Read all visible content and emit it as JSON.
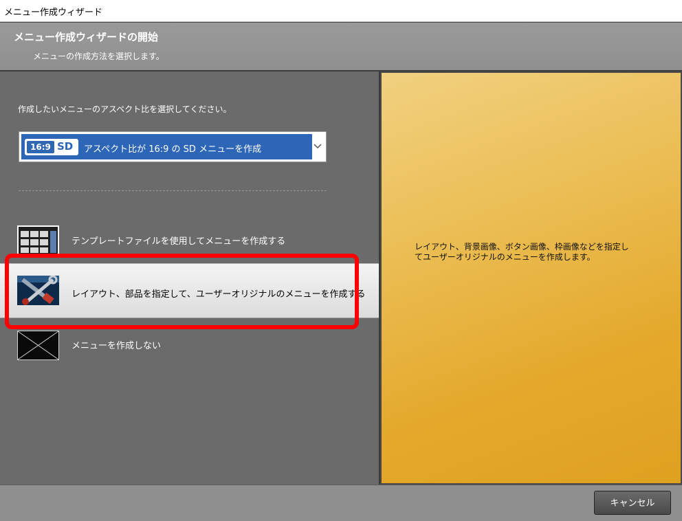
{
  "window": {
    "title": "メニュー作成ウィザード"
  },
  "header": {
    "title": "メニュー作成ウィザードの開始",
    "subtitle": "メニューの作成方法を選択します。"
  },
  "left": {
    "prompt": "作成したいメニューのアスペクト比を選択してください。",
    "aspect_select": {
      "badge_ratio": "16:9",
      "badge_format": "SD",
      "selected_text": "アスペクト比が 16:9 の SD メニューを作成"
    },
    "options": [
      {
        "label": "テンプレートファイルを使用してメニューを作成する",
        "icon": "template-icon",
        "selected": false
      },
      {
        "label": "レイアウト、部品を指定して、ユーザーオリジナルのメニューを作成する",
        "icon": "tools-icon",
        "selected": true
      },
      {
        "label": "メニューを作成しない",
        "icon": "no-menu-icon",
        "selected": false
      }
    ]
  },
  "right": {
    "description": "レイアウト、背景画像、ボタン画像、枠画像などを指定し\nてユーザーオリジナルのメニューを作成します。"
  },
  "footer": {
    "cancel_label": "キャンセル"
  },
  "colors": {
    "highlight": "#ff0000",
    "accent": "#2d66b6",
    "panel": "#e4a92c"
  }
}
